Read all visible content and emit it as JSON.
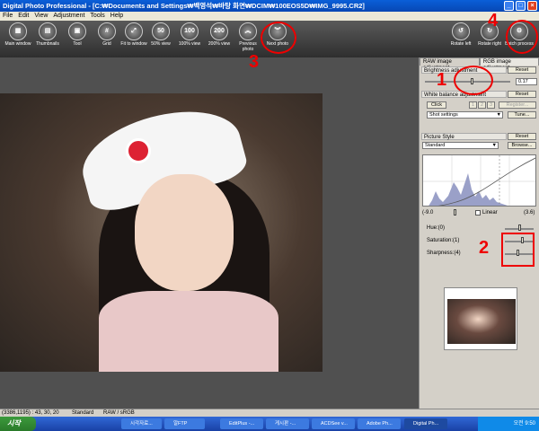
{
  "window": {
    "title": "Digital Photo Professional - [C:₩Documents and Settings₩백영석₩바탕 화면₩DCIM₩100EOS5D₩IMG_9995.CR2]",
    "minimize": "_",
    "maximize": "□",
    "close": "×"
  },
  "menu": [
    "File",
    "Edit",
    "View",
    "Adjustment",
    "Tools",
    "Help"
  ],
  "toolbar": {
    "main_window": "Main window",
    "thumbnails": "Thumbnails",
    "tool": "Tool",
    "grid": "Grid",
    "fit_to_window": "Fit to window",
    "zoom_50": "50",
    "zoom_50_label": "50% view",
    "zoom_100": "100",
    "zoom_100_label": "100% view",
    "zoom_200": "200",
    "zoom_200_label": "200% view",
    "previous_photo": "Previous photo",
    "next_photo": "Next photo",
    "rotate_left": "Rotate left",
    "rotate_right": "Rotate right",
    "batch_process": "Batch process"
  },
  "panel": {
    "tab_raw": "RAW image adjustment",
    "tab_rgb": "RGB image adjustment",
    "brightness_label": "Brightness adjustment",
    "brightness_value": "0.17",
    "reset": "Reset",
    "white_balance_label": "White balance adjustment",
    "click_button": "Click",
    "wb_slots": [
      "1",
      "2",
      "3"
    ],
    "register_button": "Register...",
    "shot_settings": "Shot settings",
    "tune_button": "Tune...",
    "picture_style_label": "Picture Style",
    "picture_style_value": "Standard",
    "browse_button": "Browse...",
    "range_min": "(-9.0",
    "linear_label": "Linear",
    "range_max": "(3.6)",
    "hue_label": "Hue:(0)",
    "saturation_label": "Saturation:(1)",
    "sharpness_label": "Sharpness:(4)"
  },
  "status": {
    "coords": "(3386,1195) :  43, 30, 20",
    "style": "Standard",
    "colorspace": "RAW / sRGB"
  },
  "taskbar": {
    "start": "시작",
    "tasks": [
      "시각자료...",
      "알FTP",
      "EditPlus -...",
      "게시판 -...",
      "ACDSee v...",
      "Adobe Ph...",
      "Digital Ph..."
    ],
    "time": "오전 9:50"
  },
  "annotations": [
    "1",
    "2",
    "3",
    "4"
  ],
  "colors": {
    "accent": "#e00000",
    "titlebar": "#0a5fd8",
    "viewer_bg": "#505050"
  }
}
